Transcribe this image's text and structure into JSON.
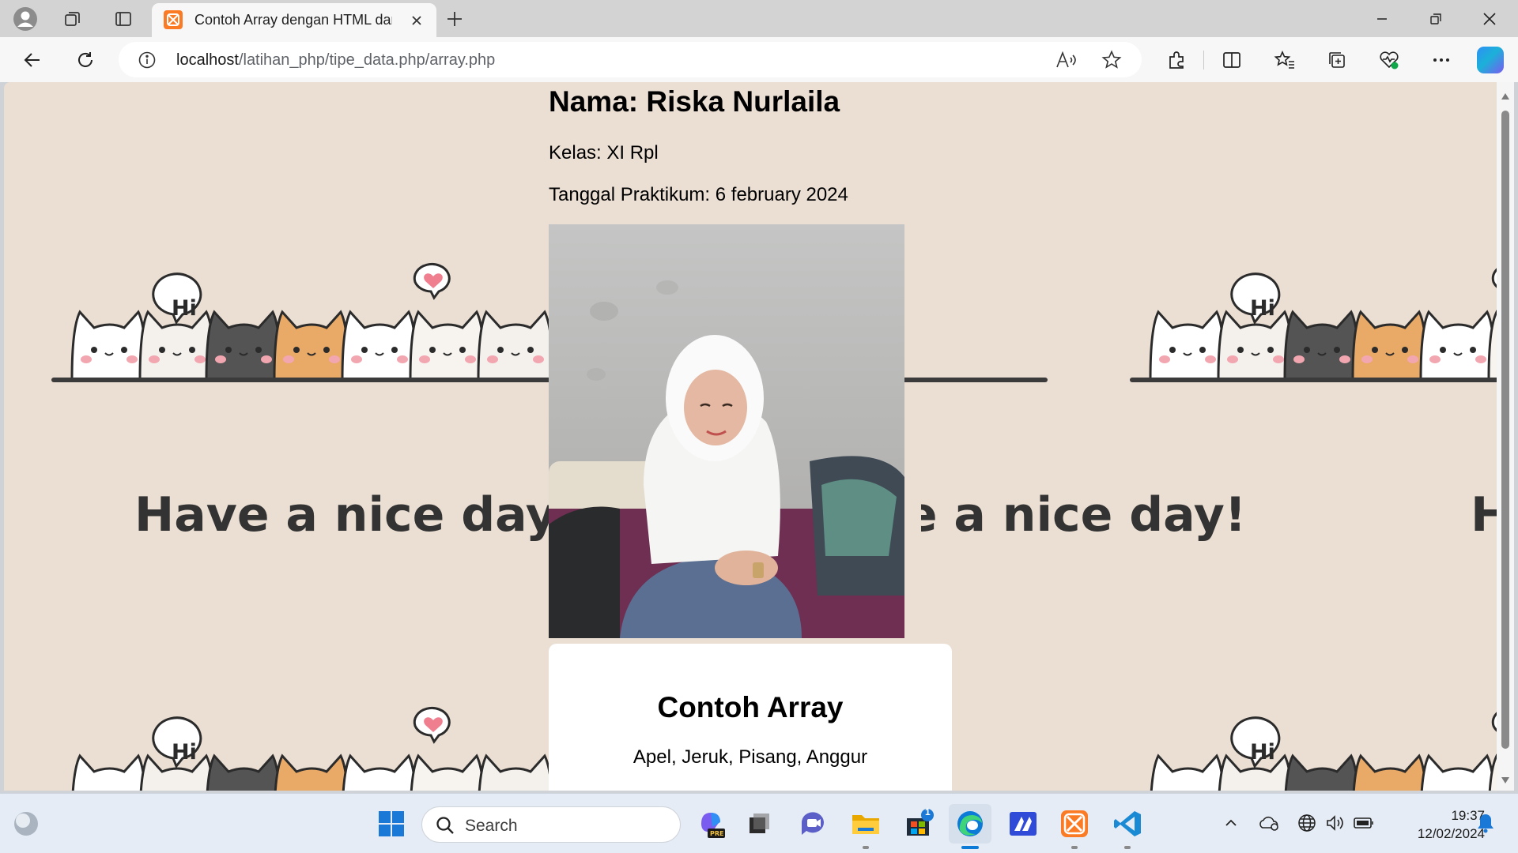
{
  "browser": {
    "tab_title": "Contoh Array dengan HTML dan CSS",
    "url_host": "localhost",
    "url_path": "/latihan_php/tipe_data.php/array.php"
  },
  "page": {
    "nama": "Nama: Riska Nurlaila",
    "kelas": "Kelas: XI Rpl",
    "tanggal": "Tanggal Praktikum: 6 february 2024",
    "card_title": "Contoh Array",
    "card_items": "Apel, Jeruk, Pisang, Anggur",
    "wallpaper_text": "Have a nice day!",
    "wallpaper_bubble": "Hi"
  },
  "taskbar": {
    "search_placeholder": "Search",
    "store_badge": "1",
    "time": "19:37",
    "date": "12/02/2024"
  },
  "colors": {
    "page_background": "#ebdfd3",
    "edge_accent": "#0c7bd8",
    "xampp_orange": "#fb7a24",
    "vscode_blue": "#1a8ad4"
  }
}
